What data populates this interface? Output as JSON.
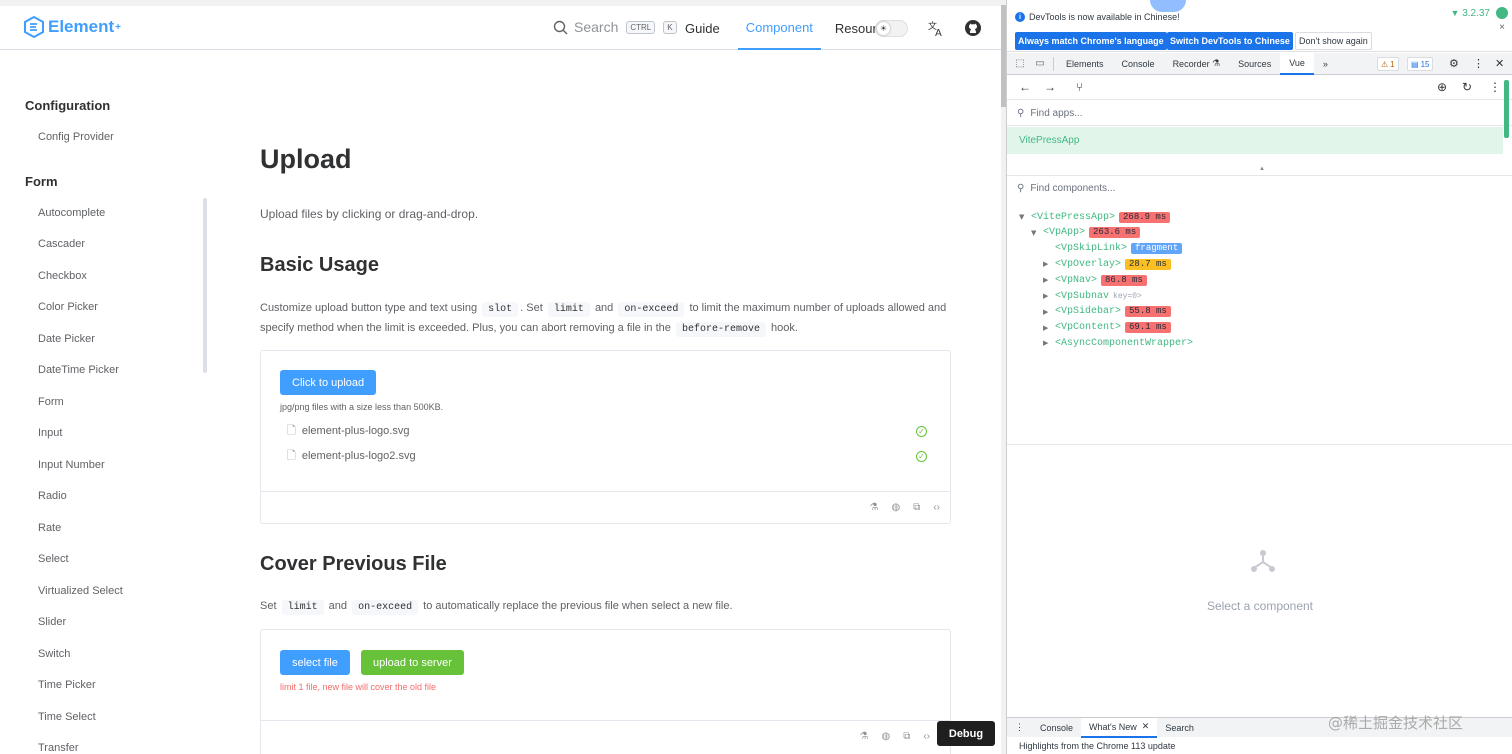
{
  "header": {
    "logo_text": "Element",
    "logo_sup": "+",
    "search_label": "Search",
    "search_kbd": [
      "CTRL",
      "K"
    ],
    "nav": [
      "Guide",
      "Component",
      "Resource"
    ],
    "active_nav": "Component"
  },
  "sidebar": {
    "groups": [
      {
        "title": "Configuration",
        "items": [
          "Config Provider"
        ]
      },
      {
        "title": "Form",
        "items": [
          "Autocomplete",
          "Cascader",
          "Checkbox",
          "Color Picker",
          "Date Picker",
          "DateTime Picker",
          "Form",
          "Input",
          "Input Number",
          "Radio",
          "Rate",
          "Select",
          "Virtualized Select",
          "Slider",
          "Switch",
          "Time Picker",
          "Time Select",
          "Transfer"
        ]
      }
    ]
  },
  "content": {
    "title": "Upload",
    "lead": "Upload files by clicking or drag-and-drop.",
    "basic": {
      "heading": "Basic Usage",
      "p1": "Customize upload button type and text using",
      "code1": "slot",
      "p2": ". Set",
      "code2": "limit",
      "p3": "and",
      "code3": "on-exceed",
      "p4": "to limit the maximum number of uploads allowed and specify method when the limit is exceeded. Plus, you can abort removing a file in the",
      "code4": "before-remove",
      "p5": "hook.",
      "button": "Click to upload",
      "tip": "jpg/png files with a size less than 500KB.",
      "files": [
        "element-plus-logo.svg",
        "element-plus-logo2.svg"
      ]
    },
    "cover": {
      "heading": "Cover Previous File",
      "p1": "Set",
      "code1": "limit",
      "p2": "and",
      "code2": "on-exceed",
      "p3": "to automatically replace the previous file when select a new file.",
      "select_button": "select file",
      "upload_button": "upload to server",
      "tip": "limit 1 file, new file will cover the old file"
    },
    "debug_button": "Debug"
  },
  "devtools": {
    "info_text": "DevTools is now available in Chinese!",
    "info_buttons": [
      "Always match Chrome's language",
      "Switch DevTools to Chinese",
      "Don't show again"
    ],
    "close": "×",
    "tabs": [
      "Elements",
      "Console",
      "Recorder",
      "Sources",
      "Vue"
    ],
    "active_tab": "Vue",
    "more_tabs": "»",
    "warnings": "1",
    "messages": "15",
    "find_apps_placeholder": "Find apps...",
    "app_name": "VitePressApp",
    "app_version": "3.2.37",
    "find_components_placeholder": "Find components...",
    "tree": [
      {
        "name": "<VitePressApp>",
        "tag": "268.9 ms",
        "tag_color": "red",
        "depth": 0,
        "arrow": "▼"
      },
      {
        "name": "<VpApp>",
        "tag": "263.6 ms",
        "tag_color": "red",
        "depth": 1,
        "arrow": "▼"
      },
      {
        "name": "<VpSkipLink>",
        "tag": "fragment",
        "tag_color": "blue",
        "depth": 2,
        "arrow": ""
      },
      {
        "name": "<VpOverlay>",
        "tag": "28.7 ms",
        "tag_color": "yellow",
        "depth": 2,
        "arrow": "▶"
      },
      {
        "name": "<VpNav>",
        "tag": "86.8 ms",
        "tag_color": "red",
        "depth": 2,
        "arrow": "▶"
      },
      {
        "name": "<VpSubnav",
        "key": "key=0>",
        "depth": 2,
        "arrow": "▶"
      },
      {
        "name": "<VpSidebar>",
        "tag": "55.8 ms",
        "tag_color": "red",
        "depth": 2,
        "arrow": "▶"
      },
      {
        "name": "<VpContent>",
        "tag": "69.1 ms",
        "tag_color": "red",
        "depth": 2,
        "arrow": "▶"
      },
      {
        "name": "<AsyncComponentWrapper>",
        "depth": 2,
        "arrow": "▶"
      }
    ],
    "empty_state": "Select a component",
    "drawer_tabs": [
      "Console",
      "What's New",
      "Search"
    ],
    "drawer_active": "What's New",
    "drawer_text": "Highlights from the Chrome 113 update"
  },
  "watermark": "@稀土掘金技术社区",
  "colors": {
    "brand": "#409eff",
    "success": "#67c23a",
    "danger": "#f56c6c",
    "vue": "#42b883",
    "chrome_blue": "#1a73e8"
  }
}
